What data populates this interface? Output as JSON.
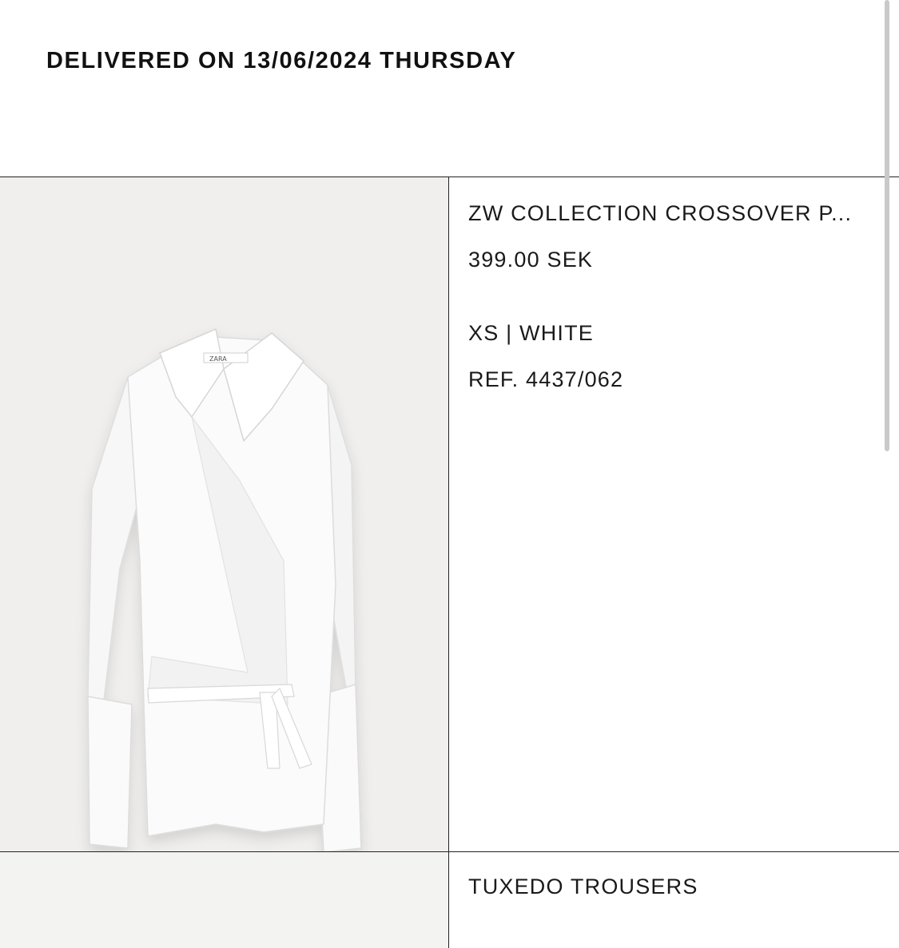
{
  "delivery": {
    "title": "DELIVERED ON 13/06/2024 THURSDAY"
  },
  "items": [
    {
      "name": "ZW COLLECTION CROSSOVER P...",
      "price": "399.00 SEK",
      "variant": "XS | WHITE",
      "reference": "REF. 4437/062",
      "image": "white-crossover-shirt-image"
    },
    {
      "name": "TUXEDO TROUSERS",
      "image": "tuxedo-trousers-image"
    }
  ]
}
